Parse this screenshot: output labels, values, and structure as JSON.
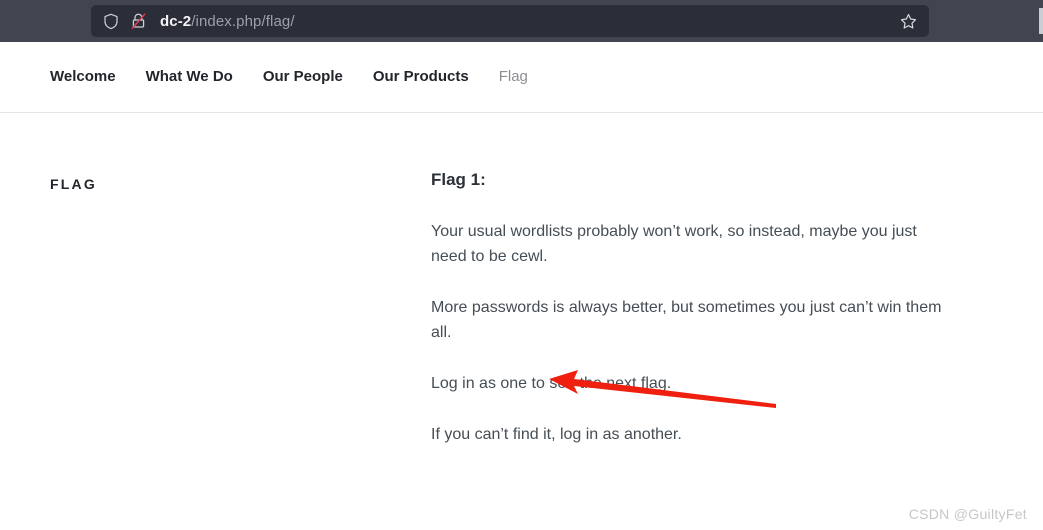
{
  "browser": {
    "url": {
      "host": "dc-2",
      "path": "/index.php/flag/"
    },
    "icons": {
      "shield": "shield-icon",
      "insecure_lock": "lock-crossed-out-icon",
      "bookmark": "star-icon"
    }
  },
  "site": {
    "nav": [
      {
        "label": "Welcome",
        "current": false
      },
      {
        "label": "What We Do",
        "current": false
      },
      {
        "label": "Our People",
        "current": false
      },
      {
        "label": "Our Products",
        "current": false
      },
      {
        "label": "Flag",
        "current": true
      }
    ],
    "page_title": "FLAG",
    "article": {
      "heading": "Flag 1:",
      "paragraphs": [
        "Your usual wordlists probably won’t work, so instead, maybe you just need to be cewl.",
        "More passwords is always better, but sometimes you just can’t win them all.",
        "Log in as one to see the next flag.",
        "If you can’t find it, log in as another."
      ]
    }
  },
  "annotation": {
    "type": "arrow",
    "color": "#f02010",
    "points_to": "cewl."
  },
  "watermark": "CSDN @GuiltyFet",
  "colors": {
    "toolbar_bg": "#42454f",
    "urlbar_bg": "#2b2e38",
    "page_bg": "#ffffff",
    "body_text": "#454d55",
    "nav_text": "#22262c",
    "nav_current": "#8b8d90",
    "arrow_red": "#f02010",
    "watermark": "#c5c7ca"
  }
}
